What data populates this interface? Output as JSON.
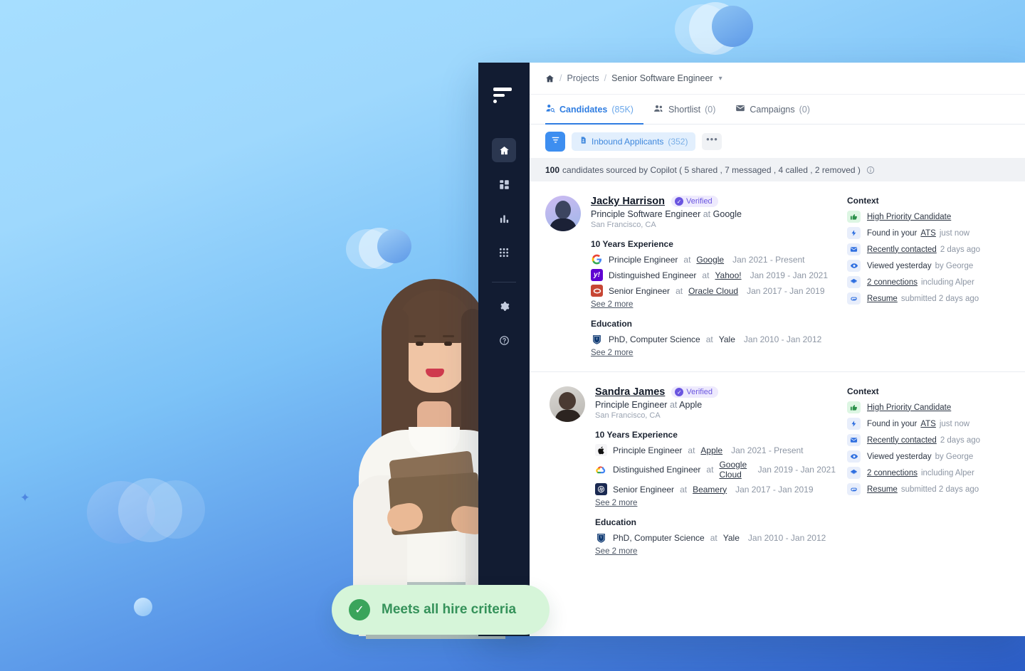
{
  "background": {
    "gradient_from": "#a6deff",
    "gradient_to": "#2d5fc9",
    "accent_blue": "#3d8ef0"
  },
  "sidebar": {
    "logo_name": "beamery-logo",
    "items": [
      {
        "name": "home",
        "label": "Home",
        "active": true
      },
      {
        "name": "dashboard",
        "label": "Dashboard",
        "active": false
      },
      {
        "name": "analytics",
        "label": "Analytics",
        "active": false
      },
      {
        "name": "apps",
        "label": "Apps",
        "active": false
      },
      {
        "name": "settings",
        "label": "Settings",
        "active": false
      },
      {
        "name": "help",
        "label": "Help",
        "active": false
      }
    ]
  },
  "breadcrumb": {
    "home_icon": "home-icon",
    "sep": "/",
    "projects": "Projects",
    "project_name": "Senior Software Engineer",
    "chevron": "⌄"
  },
  "tabs": [
    {
      "label": "Candidates",
      "count": "(85K)",
      "icon": "candidates-icon",
      "active": true
    },
    {
      "label": "Shortlist",
      "count": "(0)",
      "icon": "shortlist-icon",
      "active": false
    },
    {
      "label": "Campaigns",
      "count": "(0)",
      "icon": "campaigns-icon",
      "active": false
    }
  ],
  "filterbar": {
    "filter_icon": "filter-icon",
    "chip_icon": "document-icon",
    "chip_label": "Inbound Applicants",
    "chip_count": "(352)",
    "more_label": "•••"
  },
  "sourced": {
    "count": "100",
    "text": "candidates sourced by Copilot ( 5 shared , 7 messaged , 4 called , 2 removed )",
    "info_icon": "info-icon"
  },
  "candidates": [
    {
      "name": "Jacky Harrison",
      "verified": "Verified",
      "headline_role": "Principle Software Engineer",
      "headline_at": "at",
      "headline_company": "Google",
      "location": "San Francisco, CA",
      "experience_title": "10 Years Experience",
      "experience": [
        {
          "logo": "google-logo",
          "role": "Principle Engineer",
          "at": "at",
          "company": "Google",
          "dates": "Jan 2021 - Present"
        },
        {
          "logo": "yahoo-logo",
          "role": "Distinguished Engineer",
          "at": "at",
          "company": "Yahoo!",
          "dates": "Jan 2019 - Jan 2021"
        },
        {
          "logo": "oracle-logo",
          "role": "Senior Engineer",
          "at": "at",
          "company": "Oracle Cloud",
          "dates": "Jan 2017 - Jan 2019"
        }
      ],
      "experience_more": "See 2 more",
      "education_title": "Education",
      "education": [
        {
          "logo": "yale-logo",
          "role": "PhD, Computer Science",
          "at": "at",
          "company": "Yale",
          "dates": "Jan 2010 - Jan 2012"
        }
      ],
      "education_more": "See 2 more",
      "context_title": "Context",
      "context": [
        {
          "icon": "thumbs-up-icon",
          "tone": "green",
          "label": "High Priority Candidate",
          "sub": ""
        },
        {
          "icon": "bolt-icon",
          "tone": "blue",
          "label_pre": "Found in your",
          "label": "ATS",
          "sub": "just now"
        },
        {
          "icon": "envelope-icon",
          "tone": "blue",
          "label": "Recently contacted",
          "sub": "2 days ago"
        },
        {
          "icon": "eye-icon",
          "tone": "blue",
          "label": "Viewed yesterday",
          "sub": "by George",
          "plain": true
        },
        {
          "icon": "network-icon",
          "tone": "blue",
          "label": "2 connections",
          "sub": "including Alper"
        },
        {
          "icon": "paperclip-icon",
          "tone": "blue",
          "label": "Resume",
          "sub": "submitted 2 days ago"
        }
      ]
    },
    {
      "name": "Sandra James",
      "verified": "Verified",
      "headline_role": "Principle Engineer",
      "headline_at": "at",
      "headline_company": "Apple",
      "location": "San Francisco, CA",
      "experience_title": "10 Years Experience",
      "experience": [
        {
          "logo": "apple-logo",
          "role": "Principle Engineer",
          "at": "at",
          "company": "Apple",
          "dates": "Jan 2021 - Present"
        },
        {
          "logo": "google-cloud-logo",
          "role": "Distinguished Engineer",
          "at": "at",
          "company": "Google Cloud",
          "dates": "Jan 2019 - Jan 2021"
        },
        {
          "logo": "beamery-logo",
          "role": "Senior Engineer",
          "at": "at",
          "company": "Beamery",
          "dates": "Jan 2017 - Jan 2019"
        }
      ],
      "experience_more": "See 2 more",
      "education_title": "Education",
      "education": [
        {
          "logo": "yale-logo",
          "role": "PhD, Computer Science",
          "at": "at",
          "company": "Yale",
          "dates": "Jan 2010 - Jan 2012"
        }
      ],
      "education_more": "See 2 more",
      "context_title": "Context",
      "context": [
        {
          "icon": "thumbs-up-icon",
          "tone": "green",
          "label": "High Priority Candidate",
          "sub": ""
        },
        {
          "icon": "bolt-icon",
          "tone": "blue",
          "label_pre": "Found in your",
          "label": "ATS",
          "sub": "just now"
        },
        {
          "icon": "envelope-icon",
          "tone": "blue",
          "label": "Recently contacted",
          "sub": "2 days ago"
        },
        {
          "icon": "eye-icon",
          "tone": "blue",
          "label": "Viewed yesterday",
          "sub": "by George",
          "plain": true
        },
        {
          "icon": "network-icon",
          "tone": "blue",
          "label": "2 connections",
          "sub": "including Alper"
        },
        {
          "icon": "paperclip-icon",
          "tone": "blue",
          "label": "Resume",
          "sub": "submitted 2 days ago"
        }
      ]
    }
  ],
  "badge": {
    "icon": "check-circle-icon",
    "text": "Meets all hire criteria",
    "bg": "#d6f5d9",
    "fg": "#35925a"
  }
}
